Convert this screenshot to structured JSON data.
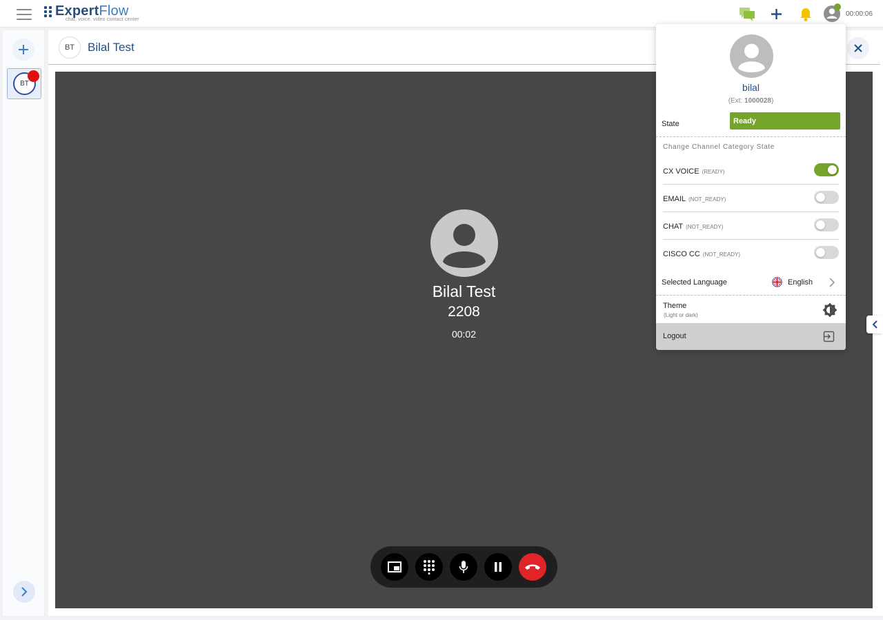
{
  "topbar": {
    "logo_primary": "Expert",
    "logo_secondary": "Flow",
    "logo_tagline": "chat. voice. video contact center",
    "timer": "00:00:06"
  },
  "rail": {
    "chip_initials": "BT"
  },
  "conversation": {
    "initials": "BT",
    "name": "Bilal Test"
  },
  "call": {
    "caller_name": "Bilal Test",
    "caller_number": "2208",
    "duration": "00:02"
  },
  "profile": {
    "username": "bilal",
    "ext_prefix": "(Ext: ",
    "ext_number": "1000028",
    "ext_suffix": ")",
    "state_label": "State",
    "state_value": "Ready",
    "channel_section_title": "Change Channel Category State",
    "channels": [
      {
        "name": "CX VOICE",
        "state": "(READY)",
        "enabled": true
      },
      {
        "name": "EMAIL",
        "state": "(NOT_READY)",
        "enabled": false
      },
      {
        "name": "CHAT",
        "state": "(NOT_READY)",
        "enabled": false
      },
      {
        "name": "CISCO CC",
        "state": "(NOT_READY)",
        "enabled": false
      }
    ],
    "language_label": "Selected Language",
    "language_value": "English",
    "theme_label": "Theme",
    "theme_sub": "(Light or dark)",
    "logout_label": "Logout"
  },
  "colors": {
    "accent_green": "#74a52a",
    "brand_blue": "#1f4f8a",
    "end_call_red": "#e0252a",
    "notification_yellow": "#f5c400"
  }
}
